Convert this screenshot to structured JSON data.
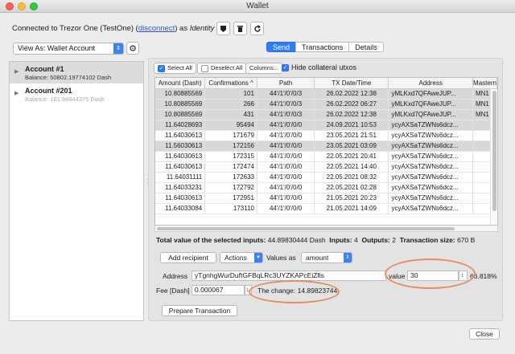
{
  "window": {
    "title": "Wallet"
  },
  "header": {
    "connected_prefix": "Connected to Trezor One (TestOne) (",
    "disconnect_link": "disconnect",
    "connected_mid": ") as ",
    "identity": "Identity #1"
  },
  "view_as": {
    "value": "View As: Wallet Account"
  },
  "accounts": [
    {
      "name": "Account #1",
      "balance": "Balance: 50802.19774102 Dash"
    },
    {
      "name": "Account #201",
      "balance": "Balance: 181.94844375 Dash"
    }
  ],
  "tabs": [
    {
      "label": "Send"
    },
    {
      "label": "Transactions"
    },
    {
      "label": "Details"
    }
  ],
  "toolbar": {
    "select_all": "Select All",
    "deselect_all": "Deselect All",
    "columns": "Columns...",
    "hide_collateral": "Hide collateral utxos"
  },
  "utxo_table": {
    "columns": [
      "Amount (Dash)",
      "Confirmations",
      "Path",
      "TX Date/Time",
      "Address",
      "Mastern"
    ],
    "sort_indicator": "^",
    "rows": [
      {
        "amount": "10.80885569",
        "conf": "101",
        "path": "44'/1'/0'/0/3",
        "date": "26.02.2022 12:38",
        "address": "yMLKxd7QFAweJUP...",
        "mn": "MN1",
        "selected": true
      },
      {
        "amount": "10.80885569",
        "conf": "266",
        "path": "44'/1'/0'/0/3",
        "date": "26.02.2022 06:27",
        "address": "yMLKxd7QFAweJUP...",
        "mn": "MN1",
        "selected": true
      },
      {
        "amount": "10.80885569",
        "conf": "431",
        "path": "44'/1'/0'/0/3",
        "date": "26.02.2022 12:38",
        "address": "yMLKxd7QFAweJUP...",
        "mn": "MN1",
        "selected": true
      },
      {
        "amount": "11.64028693",
        "conf": "95494",
        "path": "44'/1'/0'/0/0",
        "date": "24.09.2021 10:53",
        "address": "ycyAXSaTZWNs6dcz...",
        "mn": "",
        "selected": true
      },
      {
        "amount": "11.64030613",
        "conf": "171679",
        "path": "44'/1'/0'/0/0",
        "date": "23.05.2021 21:51",
        "address": "ycyAXSaTZWNs6dcz...",
        "mn": "",
        "selected": false
      },
      {
        "amount": "11.56030613",
        "conf": "172156",
        "path": "44'/1'/0'/0/0",
        "date": "23.05.2021 03:09",
        "address": "ycyAXSaTZWNs6dcz...",
        "mn": "",
        "selected": true
      },
      {
        "amount": "11.64030613",
        "conf": "172315",
        "path": "44'/1'/0'/0/0",
        "date": "22.05.2021 20:41",
        "address": "ycyAXSaTZWNs6dcz...",
        "mn": "",
        "selected": false
      },
      {
        "amount": "11.64030613",
        "conf": "172474",
        "path": "44'/1'/0'/0/0",
        "date": "22.05.2021 14:40",
        "address": "ycyAXSaTZWNs6dcz...",
        "mn": "",
        "selected": false
      },
      {
        "amount": "11.64031111",
        "conf": "172633",
        "path": "44'/1'/0'/0/0",
        "date": "22.05.2021 08:32",
        "address": "ycyAXSaTZWNs6dcz...",
        "mn": "",
        "selected": false
      },
      {
        "amount": "11.64033231",
        "conf": "172792",
        "path": "44'/1'/0'/0/0",
        "date": "22.05.2021 02:28",
        "address": "ycyAXSaTZWNs6dcz...",
        "mn": "",
        "selected": false
      },
      {
        "amount": "11.64030613",
        "conf": "172951",
        "path": "44'/1'/0'/0/0",
        "date": "21.05.2021 20:23",
        "address": "ycyAXSaTZWNs6dcz...",
        "mn": "",
        "selected": false
      },
      {
        "amount": "11.64033084",
        "conf": "173110",
        "path": "44'/1'/0'/0/0",
        "date": "21.05.2021 14:09",
        "address": "ycyAXSaTZWNs6dcz...",
        "mn": "",
        "selected": false
      }
    ]
  },
  "summary": {
    "total_label": "Total value of the selected inputs:",
    "total_value": "44.89830444 Dash",
    "inputs_label": "Inputs:",
    "inputs_value": "4",
    "outputs_label": "Outputs:",
    "outputs_value": "2",
    "size_label": "Transaction size:",
    "size_value": "670 B"
  },
  "recipient": {
    "add_button": "Add recipient",
    "actions": "Actions",
    "values_as_label": "Values as",
    "values_as": "amount",
    "address_label": "Address",
    "address_value": "yTgnhgWurDuftGFBqLRc3UYZKAPcEiZfis",
    "value_label": "value",
    "value": "30",
    "percent": "66.818%",
    "fee_label": "Fee [Dash]",
    "fee_value": "0.000067",
    "change_label": "The change: 14.89823744"
  },
  "buttons": {
    "prepare": "Prepare Transaction",
    "close": "Close"
  },
  "colors": {
    "accent": "#2f7df6",
    "annotation": "#e58c63",
    "selected_row": "#d8d8d8"
  }
}
